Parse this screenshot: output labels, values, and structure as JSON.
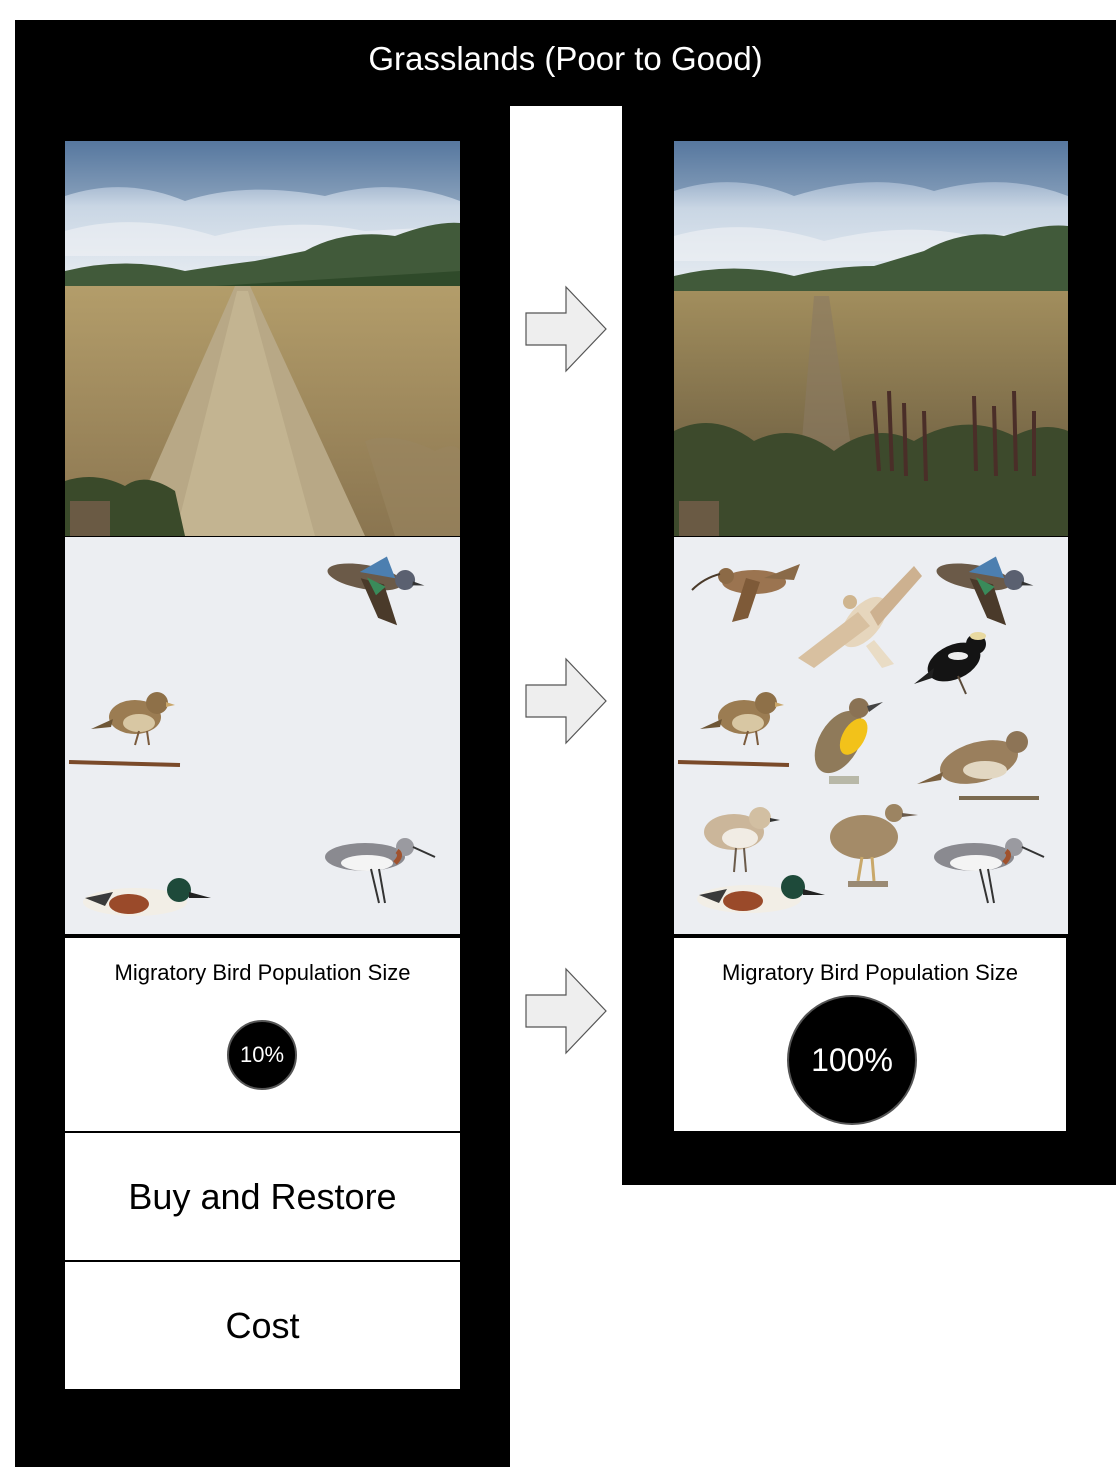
{
  "title": "Grasslands (Poor to Good)",
  "left": {
    "population_label": "Migratory Bird Population Size",
    "population_value": "10%",
    "population_fraction": 0.1,
    "buy_button": "Buy and Restore",
    "cost_button": "Cost",
    "birds": [
      "blue-winged-teal-icon",
      "grasshopper-sparrow-icon",
      "northern-shoveler-icon",
      "wilsons-phalarope-icon"
    ]
  },
  "right": {
    "population_label": "Migratory Bird Population Size",
    "population_value": "100%",
    "population_fraction": 1.0,
    "birds": [
      "long-billed-curlew-icon",
      "ferruginous-hawk-icon",
      "blue-winged-teal-icon",
      "bobolink-icon",
      "grasshopper-sparrow-icon",
      "western-meadowlark-icon",
      "vesper-sparrow-icon",
      "mountain-plover-icon",
      "upland-sandpiper-icon",
      "northern-shoveler-icon",
      "wilsons-phalarope-icon"
    ]
  },
  "colors": {
    "background": "#000000",
    "bird_panel": "#eceef2",
    "arrow_fill": "#eeeeee"
  }
}
